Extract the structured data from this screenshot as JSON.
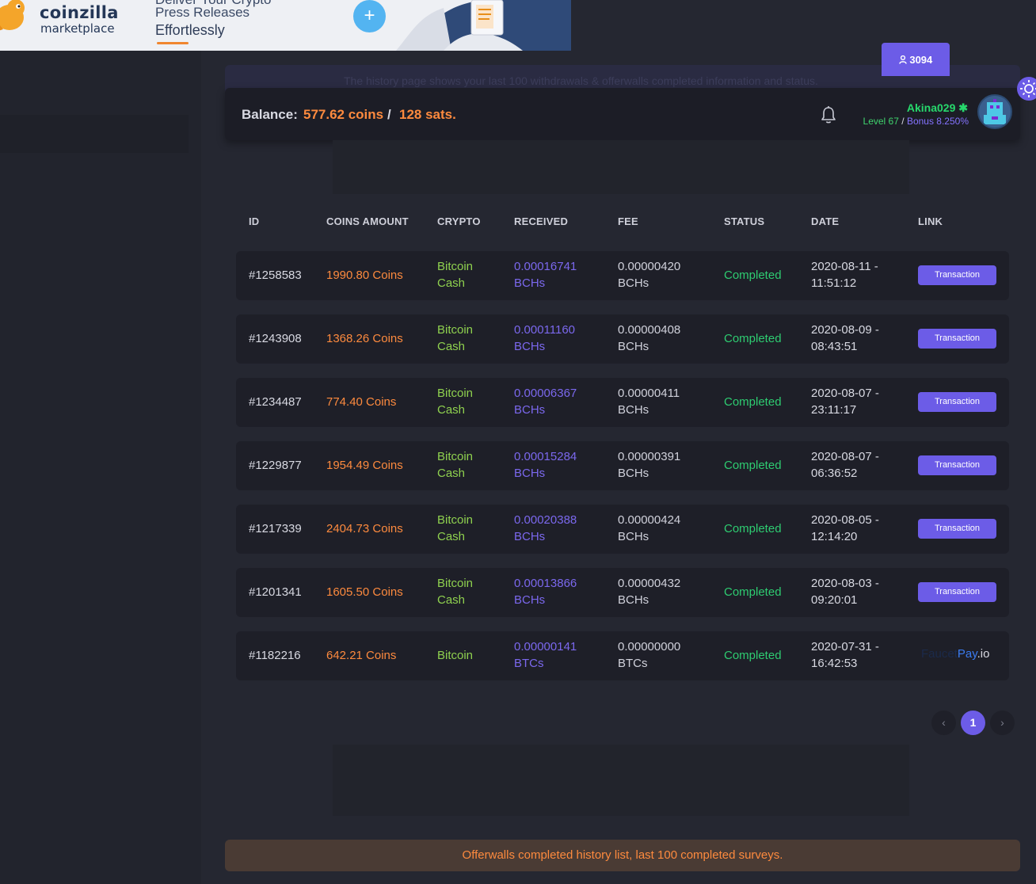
{
  "ad": {
    "brand": "coinzilla",
    "brand_sub": "marketplace",
    "line1": "Deliver Your Crypto",
    "line2": "Press Releases",
    "line3": "Effortlessly",
    "plus": "+"
  },
  "faded_notice": "The history page shows your last 100 withdrawals & offerwalls completed information and status.",
  "user_tab": {
    "count": "3094"
  },
  "header": {
    "balance_label": "Balance:",
    "coins": "577.62 coins",
    "separator": "/",
    "sats": "128 sats.",
    "username": "Akina029",
    "level": "Level 67",
    "level_sep": "/",
    "bonus": "Bonus 8.250%"
  },
  "table": {
    "headers": [
      "ID",
      "COINS AMOUNT",
      "CRYPTO",
      "RECEIVED",
      "FEE",
      "STATUS",
      "DATE",
      "LINK"
    ],
    "rows": [
      {
        "id": "#1258583",
        "coins": "1990.80 Coins",
        "crypto1": "Bitcoin",
        "crypto2": "Cash",
        "recv1": "0.00016741",
        "recv2": "BCHs",
        "fee1": "0.00000420",
        "fee2": "BCHs",
        "status": "Completed",
        "date1": "2020-08-11 -",
        "date2": "11:51:12",
        "link": "Transaction"
      },
      {
        "id": "#1243908",
        "coins": "1368.26 Coins",
        "crypto1": "Bitcoin",
        "crypto2": "Cash",
        "recv1": "0.00011160",
        "recv2": "BCHs",
        "fee1": "0.00000408",
        "fee2": "BCHs",
        "status": "Completed",
        "date1": "2020-08-09 -",
        "date2": "08:43:51",
        "link": "Transaction"
      },
      {
        "id": "#1234487",
        "coins": "774.40 Coins",
        "crypto1": "Bitcoin",
        "crypto2": "Cash",
        "recv1": "0.00006367",
        "recv2": "BCHs",
        "fee1": "0.00000411",
        "fee2": "BCHs",
        "status": "Completed",
        "date1": "2020-08-07 -",
        "date2": "23:11:17",
        "link": "Transaction"
      },
      {
        "id": "#1229877",
        "coins": "1954.49 Coins",
        "crypto1": "Bitcoin",
        "crypto2": "Cash",
        "recv1": "0.00015284",
        "recv2": "BCHs",
        "fee1": "0.00000391",
        "fee2": "BCHs",
        "status": "Completed",
        "date1": "2020-08-07 -",
        "date2": "06:36:52",
        "link": "Transaction"
      },
      {
        "id": "#1217339",
        "coins": "2404.73 Coins",
        "crypto1": "Bitcoin",
        "crypto2": "Cash",
        "recv1": "0.00020388",
        "recv2": "BCHs",
        "fee1": "0.00000424",
        "fee2": "BCHs",
        "status": "Completed",
        "date1": "2020-08-05 -",
        "date2": "12:14:20",
        "link": "Transaction"
      },
      {
        "id": "#1201341",
        "coins": "1605.50 Coins",
        "crypto1": "Bitcoin",
        "crypto2": "Cash",
        "recv1": "0.00013866",
        "recv2": "BCHs",
        "fee1": "0.00000432",
        "fee2": "BCHs",
        "status": "Completed",
        "date1": "2020-08-03 -",
        "date2": "09:20:01",
        "link": "Transaction"
      },
      {
        "id": "#1182216",
        "coins": "642.21 Coins",
        "crypto1": "Bitcoin",
        "recv1": "0.00000141",
        "recv2": "BTCs",
        "fee1": "0.00000000",
        "fee2": "BTCs",
        "status": "Completed",
        "date1": "2020-07-31 -",
        "date2": "16:42:53",
        "fp_a": "Faucet",
        "fp_b": "Pay",
        "fp_c": ".io"
      }
    ]
  },
  "pagination": {
    "prev": "‹",
    "current": "1",
    "next": "›"
  },
  "alert": "Offerwalls completed history list, last 100 completed surveys.",
  "colors": {
    "accent": "#6c5ce7",
    "orange": "#fd8a3e",
    "green": "#2ecc71"
  }
}
